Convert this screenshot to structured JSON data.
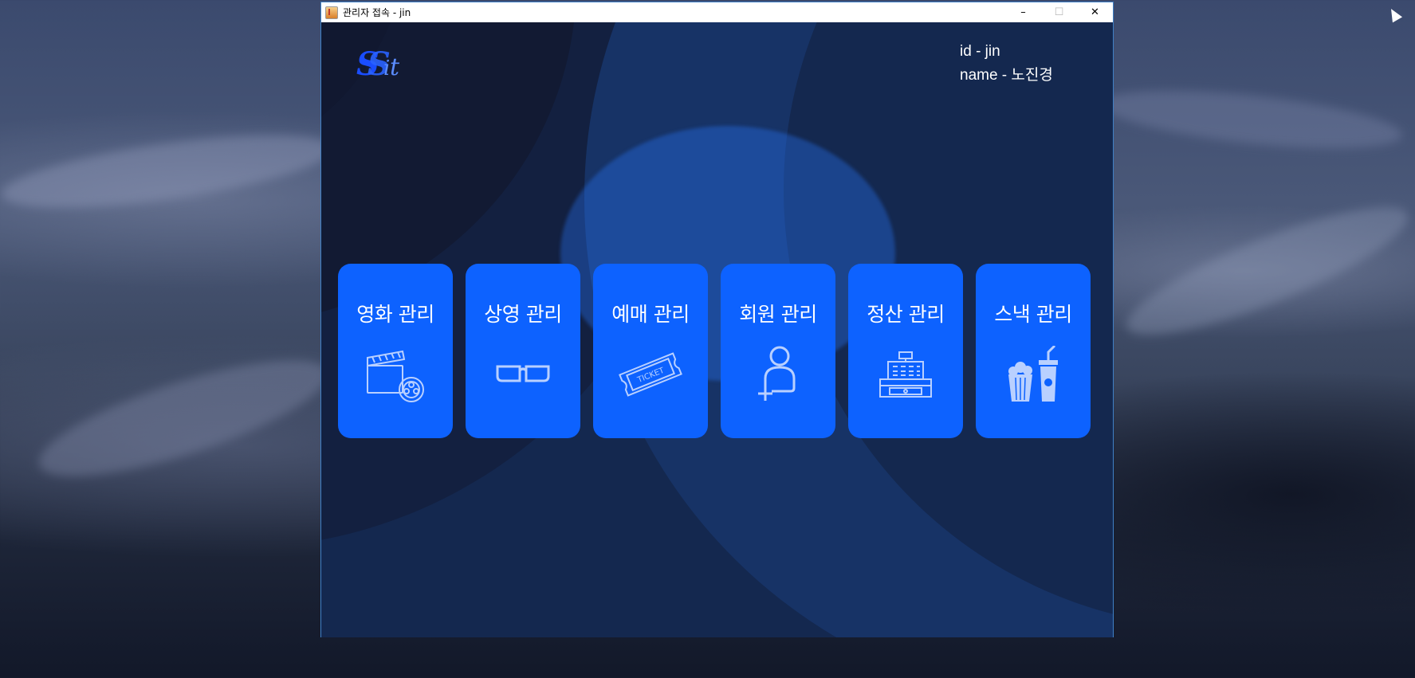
{
  "window": {
    "title": "관리자 접속 - jin",
    "controls": {
      "minimize": "–",
      "maximize": "☐",
      "close": "✕"
    }
  },
  "logo": {
    "text": "SSit"
  },
  "user": {
    "id_line": "id - jin",
    "name_line": "name - 노진경"
  },
  "menu": [
    {
      "label": "영화 관리",
      "icon": "movie-clapper-film-reel-icon"
    },
    {
      "label": "상영 관리",
      "icon": "3d-glasses-icon"
    },
    {
      "label": "예매 관리",
      "icon": "ticket-icon"
    },
    {
      "label": "회원 관리",
      "icon": "add-user-icon"
    },
    {
      "label": "정산 관리",
      "icon": "cash-register-icon"
    },
    {
      "label": "스낵 관리",
      "icon": "popcorn-drink-icon"
    }
  ],
  "ticket_icon_text": "TICKET",
  "colors": {
    "window_bg": "#14284f",
    "card_bg": "#0d62ff",
    "text": "#ffffff",
    "logo_blue": "#1a4dff"
  }
}
